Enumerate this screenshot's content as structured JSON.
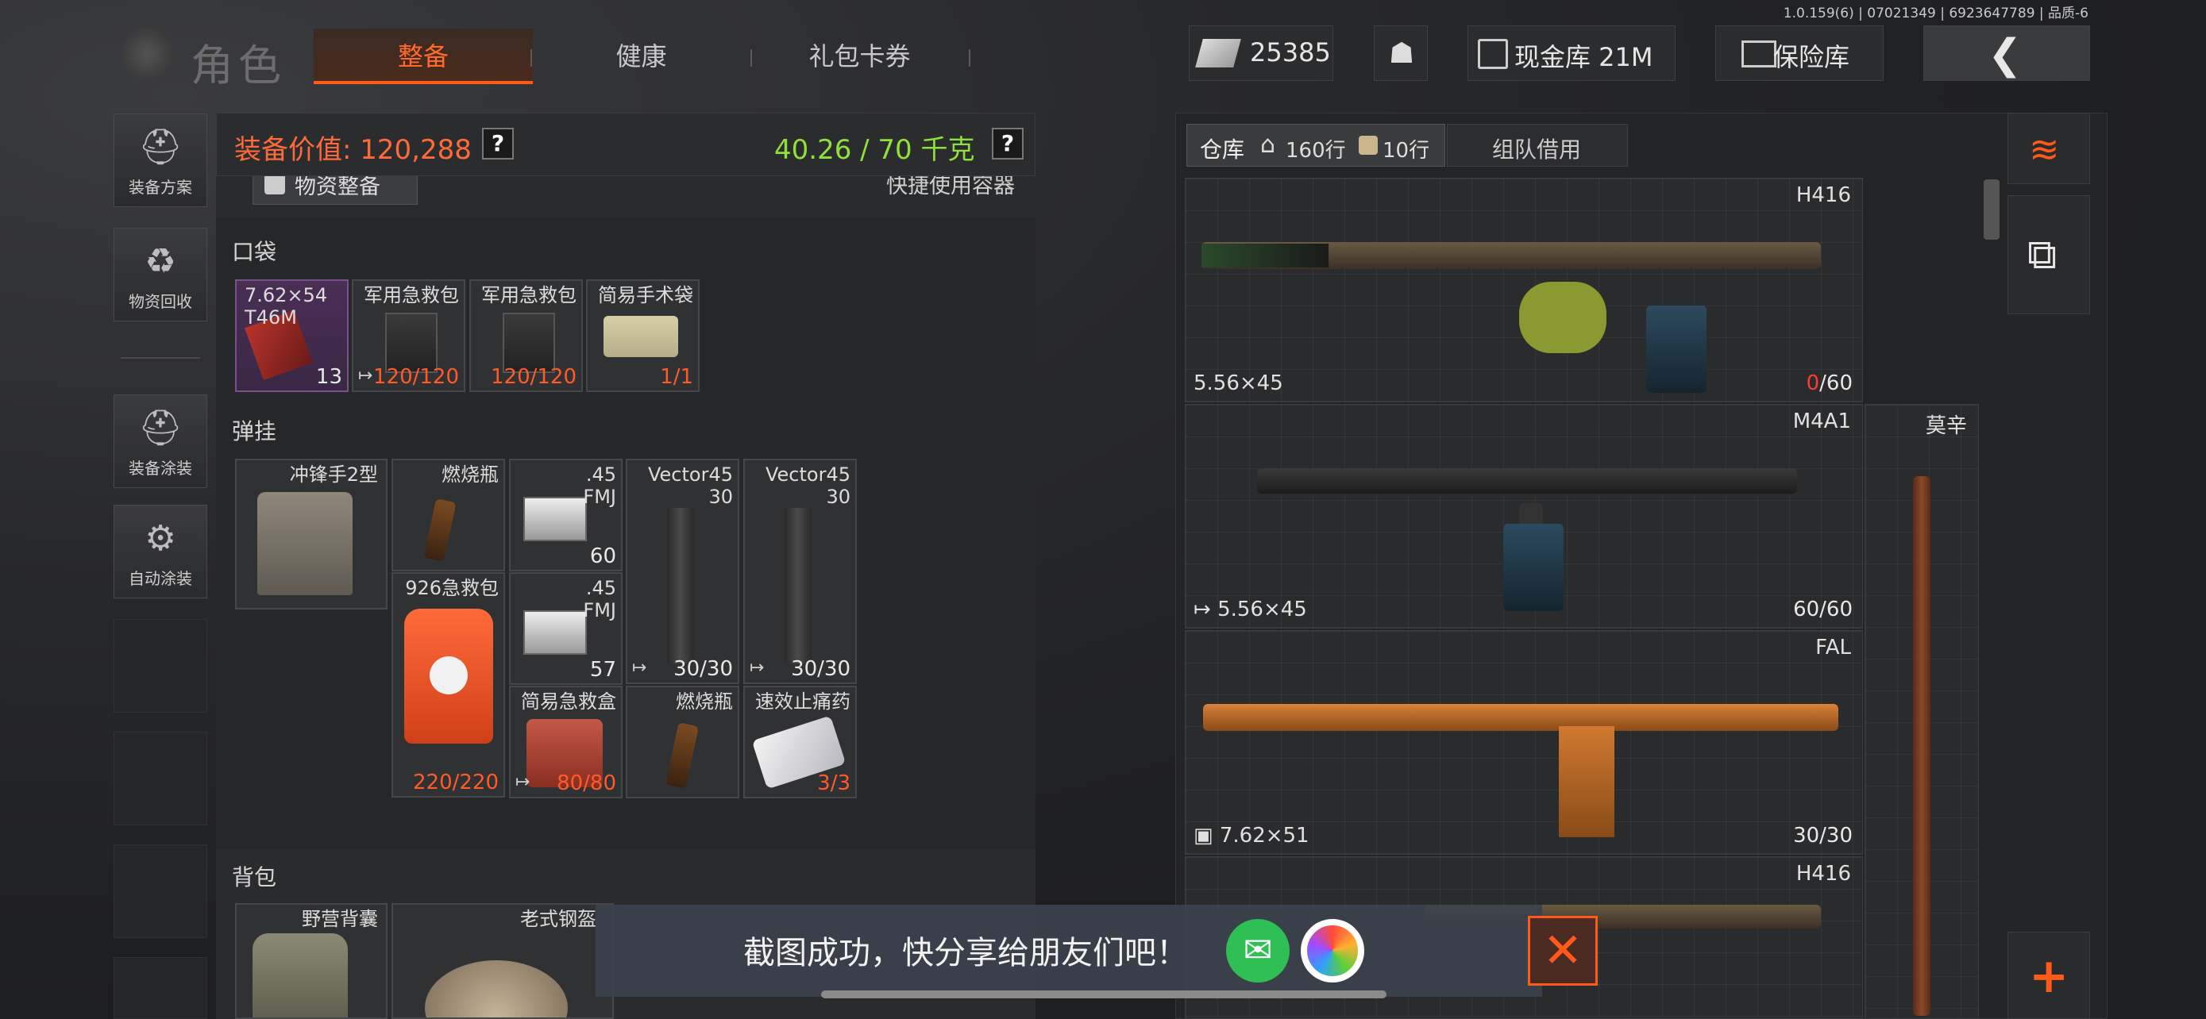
{
  "version": "1.0.159(6) | 07021349 | 6923647789 | 品质-6",
  "header": {
    "title": "角色",
    "tabs": [
      {
        "label": "整备",
        "active": true
      },
      {
        "label": "健康"
      },
      {
        "label": "礼包卡券"
      }
    ],
    "money": "25385",
    "cash_vault": "现金库 21M",
    "safe": "保险库"
  },
  "sidebar": {
    "items": [
      {
        "label": "装备方案",
        "icon": "gear-loadout-icon"
      },
      {
        "label": "物资回收",
        "icon": "recycle-icon"
      },
      {
        "label": "装备涂装",
        "icon": "paint-helmet-icon"
      },
      {
        "label": "自动涂装",
        "icon": "auto-paint-icon"
      }
    ]
  },
  "loadout": {
    "value_label": "装备价值: 120,288",
    "weight": "40.26 / 70 千克",
    "supply_button": "物资整备",
    "quick_container": "快捷使用容器",
    "pocket_label": "口袋",
    "pockets": [
      {
        "name": "7.62×54\nT46M",
        "count": "13"
      },
      {
        "name": "军用急救包",
        "count": "120/120"
      },
      {
        "name": "军用急救包",
        "count": "120/120"
      },
      {
        "name": "简易手术袋",
        "count": "1/1"
      }
    ],
    "rig_label": "弹挂",
    "rig_name": "冲锋手2型",
    "rig_items": [
      {
        "name": "燃烧瓶",
        "count": ""
      },
      {
        "name": ".45\nFMJ",
        "count": "60"
      },
      {
        "name": "Vector45\n30",
        "count": "30/30"
      },
      {
        "name": "Vector45\n30",
        "count": "30/30"
      },
      {
        "name": "926急救包",
        "count": "220/220"
      },
      {
        "name": ".45\nFMJ",
        "count": "57"
      },
      {
        "name": "简易急救盒",
        "count": "80/80"
      },
      {
        "name": "燃烧瓶",
        "count": ""
      },
      {
        "name": "速效止痛药",
        "count": "3/3"
      }
    ],
    "backpack_label": "背包",
    "backpack_name": "野营背囊",
    "helmet_name": "老式钢盔"
  },
  "storage": {
    "tab_warehouse": "仓库",
    "home_rows": "160行",
    "bag_rows": "10行",
    "tab_team": "组队借用",
    "weapons": [
      {
        "name": "H416",
        "ammo": "5.56×45",
        "count_red": "0",
        "count_rest": "/60"
      },
      {
        "name": "M4A1",
        "ammo": "5.56×45",
        "count": "60/60"
      },
      {
        "name": "FAL",
        "ammo": "7.62×51",
        "count": "30/30"
      },
      {
        "name": "H416",
        "ammo": "",
        "count": ""
      }
    ],
    "side_weapon": "莫辛"
  },
  "toast": {
    "text": "截图成功，快分享给朋友们吧！"
  },
  "colors": {
    "accent": "#ff5a1a",
    "value_red": "#ff6a3a",
    "weight_green": "#8fe03a"
  }
}
